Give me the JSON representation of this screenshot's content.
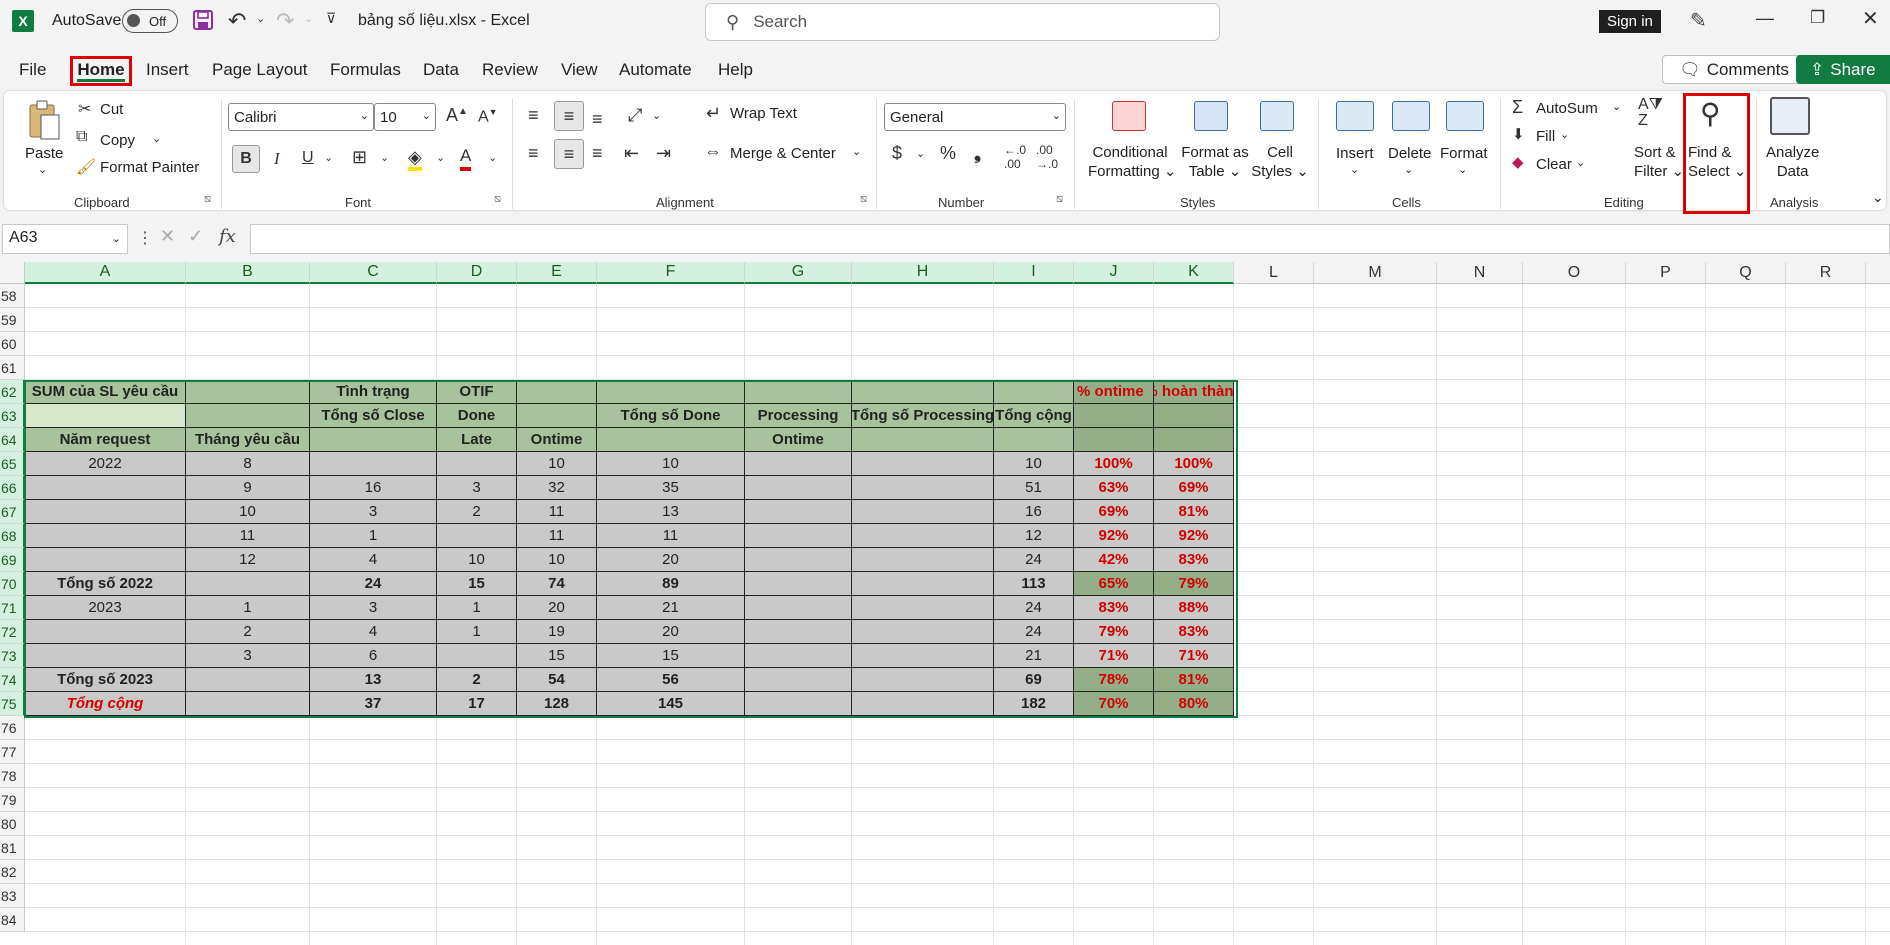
{
  "titlebar": {
    "autosave_label": "AutoSave",
    "autosave_state": "Off",
    "doc_title": "bảng số liệu.xlsx  -  Excel",
    "search_placeholder": "Search",
    "signin": "Sign in"
  },
  "menu": {
    "tabs": [
      "File",
      "Home",
      "Insert",
      "Page Layout",
      "Formulas",
      "Data",
      "Review",
      "View",
      "Automate",
      "Help"
    ],
    "comments": "Comments",
    "share": "Share"
  },
  "ribbon": {
    "clipboard": {
      "paste": "Paste",
      "cut": "Cut",
      "copy": "Copy",
      "format_painter": "Format Painter",
      "label": "Clipboard"
    },
    "font": {
      "name": "Calibri",
      "size": "10",
      "label": "Font"
    },
    "alignment": {
      "wrap_text": "Wrap Text",
      "merge_center": "Merge & Center",
      "label": "Alignment"
    },
    "number": {
      "format": "General",
      "label": "Number"
    },
    "styles": {
      "conditional_1": "Conditional",
      "conditional_2": "Formatting",
      "format_as_1": "Format as",
      "format_as_2": "Table",
      "cell_styles_1": "Cell",
      "cell_styles_2": "Styles",
      "label": "Styles"
    },
    "cells": {
      "insert": "Insert",
      "delete": "Delete",
      "format": "Format",
      "label": "Cells"
    },
    "editing": {
      "autosum": "AutoSum",
      "fill": "Fill",
      "clear": "Clear",
      "sort_1": "Sort &",
      "sort_2": "Filter",
      "find_1": "Find &",
      "find_2": "Select",
      "label": "Editing"
    },
    "analysis": {
      "analyze_1": "Analyze",
      "analyze_2": "Data",
      "label": "Analysis"
    }
  },
  "formula_bar": {
    "name_box": "A63",
    "formula": ""
  },
  "sheet": {
    "columns": [
      "A",
      "B",
      "C",
      "D",
      "E",
      "F",
      "G",
      "H",
      "I",
      "J",
      "K",
      "L",
      "M",
      "N",
      "O",
      "P",
      "Q",
      "R",
      "S"
    ],
    "selected_columns": [
      "A",
      "B",
      "C",
      "D",
      "E",
      "F",
      "G",
      "H",
      "I",
      "J",
      "K"
    ],
    "rows": [
      "58",
      "59",
      "60",
      "61",
      "62",
      "63",
      "64",
      "65",
      "66",
      "67",
      "68",
      "69",
      "70",
      "71",
      "72",
      "73",
      "74",
      "75",
      "76",
      "77",
      "78",
      "79",
      "80",
      "81",
      "82",
      "83",
      "84"
    ],
    "table": [
      [
        "SUM của SL yêu cầu",
        "",
        "Tình trạng",
        "OTIF",
        "",
        "",
        "",
        "",
        "",
        "% ontime",
        "% hoàn thành"
      ],
      [
        "",
        "",
        "Tổng số Close",
        "Done",
        "",
        "Tổng số Done",
        "Processing",
        "Tổng số Processing",
        "Tổng cộng",
        "",
        ""
      ],
      [
        "Năm request",
        "Tháng yêu cầu",
        "",
        "Late",
        "Ontime",
        "",
        "Ontime",
        "",
        "",
        "",
        ""
      ],
      [
        "2022",
        "8",
        "",
        "",
        "10",
        "10",
        "",
        "",
        "10",
        "100%",
        "100%"
      ],
      [
        "",
        "9",
        "16",
        "3",
        "32",
        "35",
        "",
        "",
        "51",
        "63%",
        "69%"
      ],
      [
        "",
        "10",
        "3",
        "2",
        "11",
        "13",
        "",
        "",
        "16",
        "69%",
        "81%"
      ],
      [
        "",
        "11",
        "1",
        "",
        "11",
        "11",
        "",
        "",
        "12",
        "92%",
        "92%"
      ],
      [
        "",
        "12",
        "4",
        "10",
        "10",
        "20",
        "",
        "",
        "24",
        "42%",
        "83%"
      ],
      [
        "Tổng số 2022",
        "",
        "24",
        "15",
        "74",
        "89",
        "",
        "",
        "113",
        "65%",
        "79%"
      ],
      [
        "2023",
        "1",
        "3",
        "1",
        "20",
        "21",
        "",
        "",
        "24",
        "83%",
        "88%"
      ],
      [
        "",
        "2",
        "4",
        "1",
        "19",
        "20",
        "",
        "",
        "24",
        "79%",
        "83%"
      ],
      [
        "",
        "3",
        "6",
        "",
        "15",
        "15",
        "",
        "",
        "21",
        "71%",
        "71%"
      ],
      [
        "Tổng số 2023",
        "",
        "13",
        "2",
        "54",
        "56",
        "",
        "",
        "69",
        "78%",
        "81%"
      ],
      [
        "Tổng cộng",
        "",
        "37",
        "17",
        "128",
        "145",
        "",
        "",
        "182",
        "70%",
        "80%"
      ]
    ]
  },
  "colors": {
    "excel_green": "#107c41",
    "highlight_red": "#e00000",
    "cell_gray": "#c9c9c9",
    "cell_green": "#a9c29e",
    "percent_red": "#d40000"
  }
}
